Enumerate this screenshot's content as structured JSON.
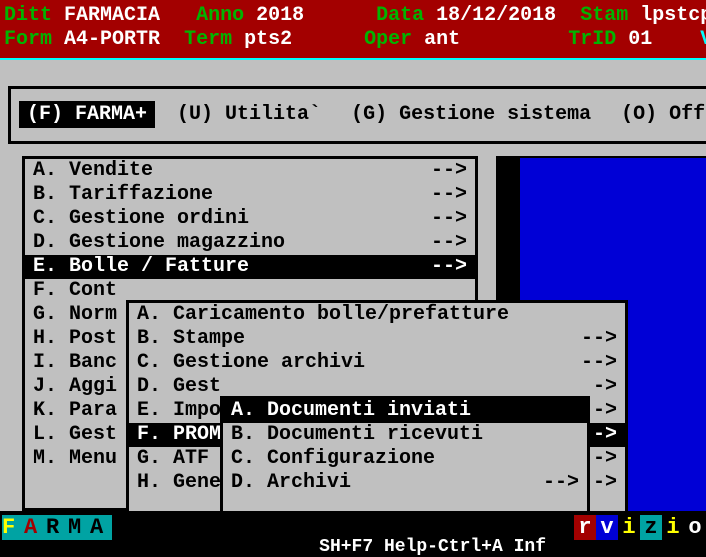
{
  "header": {
    "ditt_lbl": "Ditt",
    "ditt_val": "FARMACIA",
    "anno_lbl": "Anno",
    "anno_val": "2018",
    "data_lbl": "Data",
    "data_val": "18/12/2018",
    "stam_lbl": "Stam",
    "stam_val": "lpstcp",
    "form_lbl": "Form",
    "form_val": "A4-PORTR",
    "term_lbl": "Term",
    "term_val": "pts2",
    "oper_lbl": "Oper",
    "oper_val": "ant",
    "trid_lbl": "TrID",
    "trid_val": "01",
    "trail": "V"
  },
  "menubar": {
    "items": [
      {
        "label": "(F) FARMA+",
        "selected": true
      },
      {
        "label": "(U) Utilita`",
        "selected": false
      },
      {
        "label": "(G) Gestione sistema",
        "selected": false
      },
      {
        "label": "(O) Offi",
        "selected": false
      }
    ]
  },
  "panel1": {
    "items": [
      {
        "key": "A.",
        "label": "Vendite",
        "arrow": "-->",
        "selected": false
      },
      {
        "key": "B.",
        "label": "Tariffazione",
        "arrow": "-->",
        "selected": false
      },
      {
        "key": "C.",
        "label": "Gestione ordini",
        "arrow": "-->",
        "selected": false
      },
      {
        "key": "D.",
        "label": "Gestione magazzino",
        "arrow": "-->",
        "selected": false
      },
      {
        "key": "E.",
        "label": "Bolle / Fatture",
        "arrow": "-->",
        "selected": true
      },
      {
        "key": "F.",
        "label": "Cont",
        "arrow": "",
        "selected": false
      },
      {
        "key": "G.",
        "label": "Norm",
        "arrow": "",
        "selected": false
      },
      {
        "key": "H.",
        "label": "Post",
        "arrow": "",
        "selected": false
      },
      {
        "key": "I.",
        "label": "Banc",
        "arrow": "",
        "selected": false
      },
      {
        "key": "J.",
        "label": "Aggi",
        "arrow": "",
        "selected": false
      },
      {
        "key": "K.",
        "label": "Para",
        "arrow": "",
        "selected": false
      },
      {
        "key": "L.",
        "label": "Gest",
        "arrow": "",
        "selected": false
      },
      {
        "key": "M.",
        "label": "Menu",
        "arrow": "",
        "selected": false
      }
    ]
  },
  "panel2": {
    "items": [
      {
        "key": "A.",
        "label": "Caricamento bolle/prefatture",
        "arrow": "",
        "selected": false
      },
      {
        "key": "B.",
        "label": "Stampe",
        "arrow": "-->",
        "selected": false
      },
      {
        "key": "C.",
        "label": "Gestione archivi",
        "arrow": "-->",
        "selected": false
      },
      {
        "key": "D.",
        "label": "Gest",
        "arrow": "->",
        "selected": false
      },
      {
        "key": "E.",
        "label": "Impo",
        "arrow": "->",
        "selected": false
      },
      {
        "key": "F.",
        "label": "PROM",
        "arrow": "->",
        "selected": true
      },
      {
        "key": "G.",
        "label": "ATF",
        "arrow": "->",
        "selected": false
      },
      {
        "key": "H.",
        "label": "Gene",
        "arrow": "->",
        "selected": false
      }
    ]
  },
  "panel3": {
    "items": [
      {
        "key": "A.",
        "label": "Documenti inviati",
        "arrow": "",
        "selected": true
      },
      {
        "key": "B.",
        "label": "Documenti ricevuti",
        "arrow": "",
        "selected": false
      },
      {
        "key": "C.",
        "label": "Configurazione",
        "arrow": "",
        "selected": false
      },
      {
        "key": "D.",
        "label": "Archivi",
        "arrow": "-->",
        "selected": false
      }
    ]
  },
  "footer": {
    "branding": [
      "F",
      "A",
      "R",
      "M",
      "A"
    ],
    "help": "SH+F7 Help-Ctrl+A Inf",
    "rvizio": [
      "r",
      "v",
      "i",
      "z",
      "i",
      "o"
    ]
  }
}
